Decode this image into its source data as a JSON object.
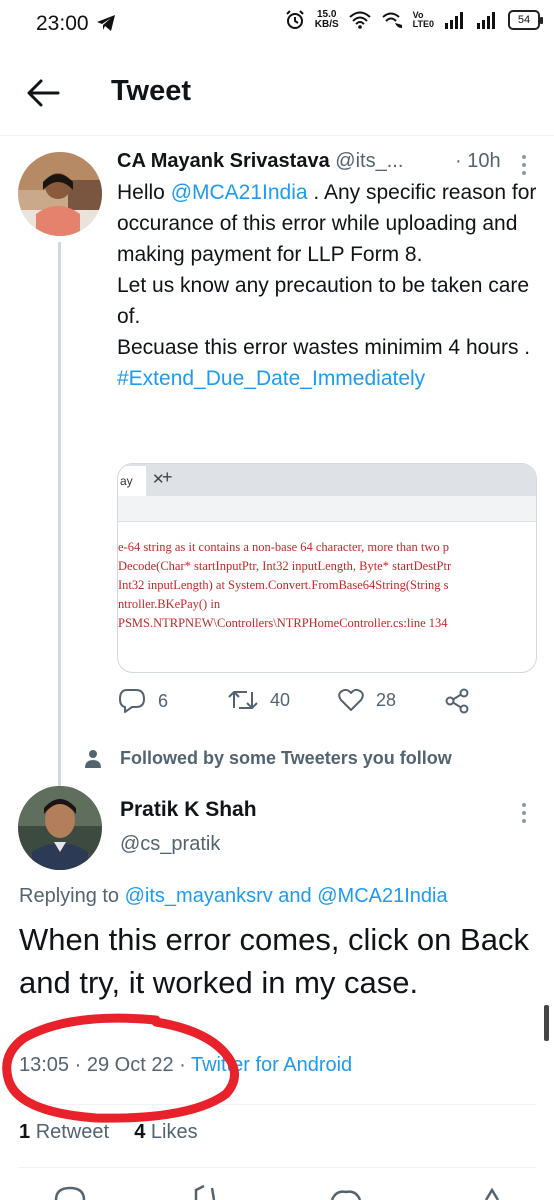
{
  "status_bar": {
    "time": "23:00",
    "speed_value": "15.0",
    "speed_unit": "KB/S",
    "volte_top": "Vo",
    "volte_bottom": "LTE0",
    "battery": "54"
  },
  "header": {
    "title": "Tweet"
  },
  "tweet1": {
    "name": "CA Mayank Srivastava",
    "handle": "@its_...",
    "time": "· 10h",
    "text_hello": "Hello ",
    "mention": "@MCA21India",
    "text_after_mention": " . Any specific reason for occurance of this error while uploading and making payment for LLP Form 8.",
    "line2": "Let us know any precaution to be taken care of.",
    "line3": "Becuase this error wastes minimim 4 hours .",
    "hashtag": "#Extend_Due_Date_Immediately",
    "media": {
      "tab_label": "ay",
      "tab_close": "✕",
      "new_tab": "+",
      "error_lines": [
        "e-64 string as it contains a non-base 64 character, more than two p",
        "Decode(Char* startInputPtr, Int32 inputLength, Byte* startDestPtr",
        "Int32 inputLength) at System.Convert.FromBase64String(String s",
        "ntroller.BKePay() in",
        "PSMS.NTRPNEW\\Controllers\\NTRPHomeController.cs:line 134"
      ]
    },
    "actions": {
      "replies": "6",
      "retweets": "40",
      "likes": "28"
    }
  },
  "social_context": "Followed by some Tweeters you follow",
  "tweet2": {
    "name": "Pratik K Shah",
    "handle": "@cs_pratik",
    "replying_prefix": "Replying to ",
    "replying_user1": "@its_mayanksrv",
    "replying_and": " and ",
    "replying_user2": "@MCA21India",
    "text": "When this error comes, click on Back and try, it worked in my case.",
    "time": "13:05",
    "date": "29 Oct 22",
    "source": "Twitter for Android",
    "retweet_count": "1",
    "retweet_label": "Retweet",
    "like_count": "4",
    "like_label": "Likes"
  },
  "colors": {
    "link": "#1d9bf0",
    "secondary_text": "#536471",
    "annotation": "#e8212b"
  },
  "icons": {
    "back": "arrow-left-icon",
    "telegram": "telegram-icon",
    "alarm": "alarm-icon",
    "wifi": "wifi-icon",
    "signal": "signal-icon",
    "reply": "reply-icon",
    "retweet": "retweet-icon",
    "like": "heart-icon",
    "share": "share-icon",
    "more": "more-vertical-icon",
    "person": "person-icon"
  }
}
